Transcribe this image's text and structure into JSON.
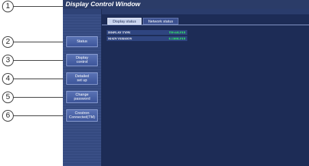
{
  "window": {
    "title": "Display Control Window"
  },
  "callouts": [
    "1",
    "2",
    "3",
    "4",
    "5",
    "6"
  ],
  "sidebar": {
    "items": [
      {
        "label": "Status"
      },
      {
        "label": "Display\ncontrol"
      },
      {
        "label": "Detailed\nset up"
      },
      {
        "label": "Change\npassword"
      },
      {
        "label": "Crestron\nConnected(TM)"
      }
    ]
  },
  "tabs": [
    {
      "label": "Display status",
      "active": true
    },
    {
      "label": "Network status",
      "active": false
    }
  ],
  "info": {
    "rows": [
      {
        "label": "DISPLAY TYPE",
        "value": "TH-##LFE8"
      },
      {
        "label": "MAIN VERSION",
        "value": "0.1300LFE8"
      }
    ]
  },
  "colors": {
    "window_bg": "#1b2a52",
    "title_bar": "#2b3c68",
    "button": "#4a63a6",
    "value_text": "#33ff66"
  }
}
